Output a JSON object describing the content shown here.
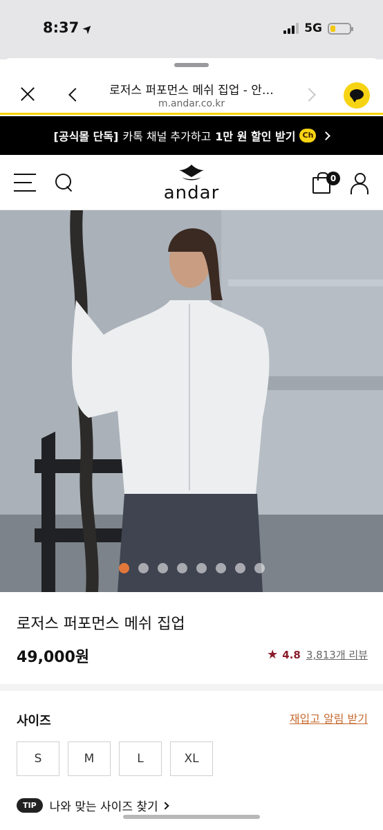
{
  "status_bar": {
    "time": "8:37",
    "network": "5G",
    "battery_level": 0.25
  },
  "browser": {
    "page_title": "로저스 퍼포먼스 메쉬 집업 - 안…",
    "url": "m.andar.co.kr"
  },
  "promo": {
    "tag": "[공식몰 단독]",
    "text_before": "카톡 채널 추가하고",
    "highlight": "1만 원 할인 받기",
    "badge": "Ch"
  },
  "header": {
    "logo_text": "andar",
    "cart_count": "0"
  },
  "gallery": {
    "total_slides": 8,
    "active_index": 0
  },
  "product": {
    "name": "로저스 퍼포먼스 메쉬 집업",
    "price": "49,000원",
    "rating": "4.8",
    "review_count": "3,813개 리뷰"
  },
  "size_section": {
    "label": "사이즈",
    "restock_link": "재입고 알림 받기",
    "options": [
      "S",
      "M",
      "L",
      "XL"
    ],
    "tip_badge": "TIP",
    "fit_link": "나와 맞는 사이즈 찾기"
  },
  "colors": {
    "accent": "#f7d413",
    "rating": "#8a1c2b",
    "restock_link": "#c46a2e",
    "active_dot": "#e2773a"
  }
}
